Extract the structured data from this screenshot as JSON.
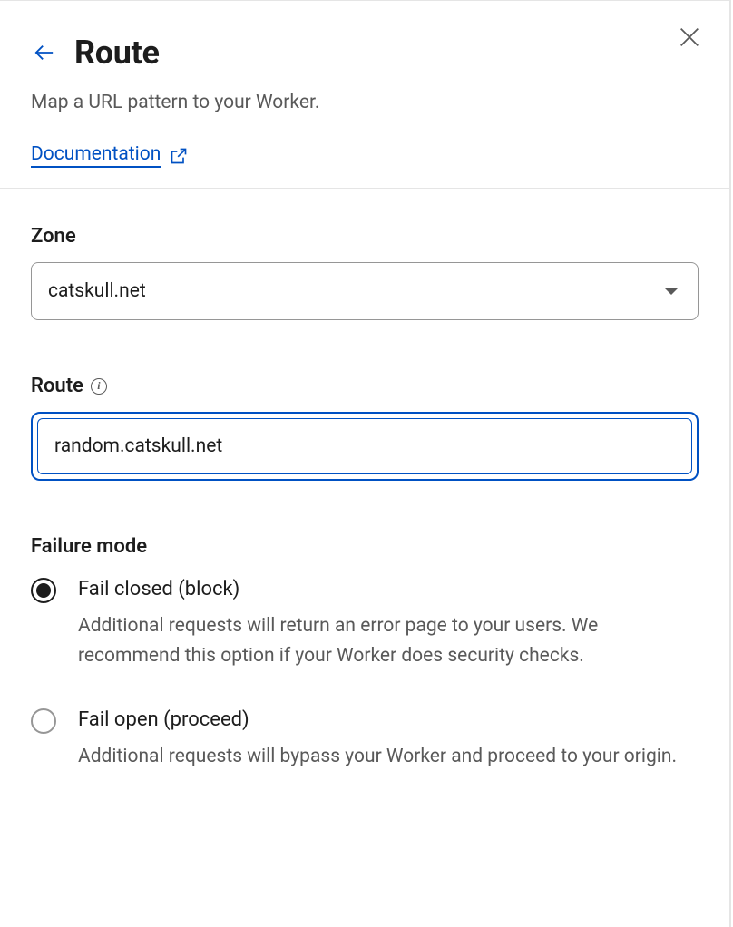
{
  "header": {
    "title": "Route",
    "subtitle": "Map a URL pattern to your Worker.",
    "doc_link": "Documentation"
  },
  "zone": {
    "label": "Zone",
    "value": "catskull.net"
  },
  "route": {
    "label": "Route",
    "value": "random.catskull.net"
  },
  "failure": {
    "label": "Failure mode",
    "options": [
      {
        "title": "Fail closed (block)",
        "desc": "Additional requests will return an error page to your users. We recommend this option if your Worker does security checks.",
        "selected": true
      },
      {
        "title": "Fail open (proceed)",
        "desc": "Additional requests will bypass your Worker and proceed to your origin.",
        "selected": false
      }
    ]
  }
}
